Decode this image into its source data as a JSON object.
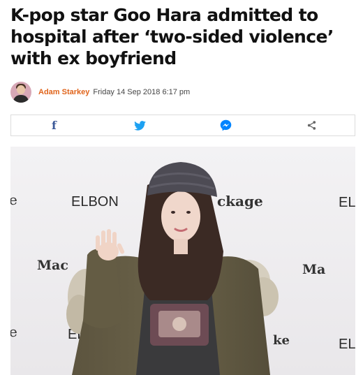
{
  "article": {
    "headline": "K-pop star Goo Hara admitted to hospital after ‘two-sided violence’ with ex boyfriend",
    "author": "Adam Starkey",
    "date": "Friday 14 Sep 2018 6:17 pm"
  },
  "share": {
    "buttons": [
      {
        "name": "facebook",
        "icon": "facebook-icon",
        "color": "#3b5998"
      },
      {
        "name": "twitter",
        "icon": "twitter-icon",
        "color": "#1da1f2"
      },
      {
        "name": "messenger",
        "icon": "messenger-icon",
        "color": "#0084ff"
      },
      {
        "name": "share",
        "icon": "share-icon",
        "color": "#666666"
      }
    ]
  },
  "photo": {
    "backdrop_words": [
      "ELBON",
      "ckage",
      "EL",
      "Mac",
      "Ma",
      "EL",
      "e",
      "e",
      "ke",
      "EL"
    ]
  }
}
